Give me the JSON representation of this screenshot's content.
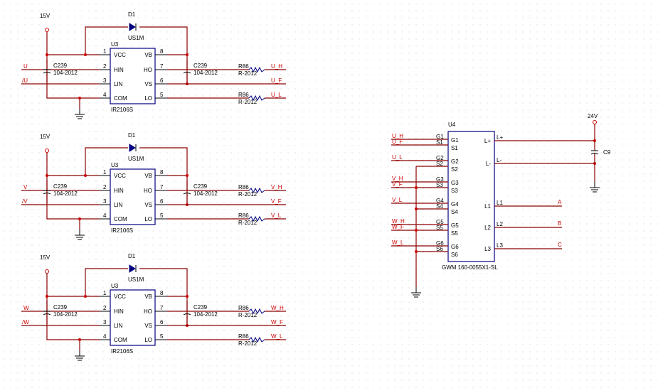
{
  "colors": {
    "background": "#ffffff",
    "wire": "#8b0000",
    "net_label": "#cc0000",
    "ic_outline": "#000080",
    "grid_dot": "#c8c8c8"
  },
  "drivers": [
    {
      "supply": "15V",
      "diode": {
        "ref": "D1",
        "part": "US1M"
      },
      "ic": {
        "ref": "U3",
        "part": "IR2106S",
        "left_pins": [
          {
            "num": "1",
            "name": "VCC"
          },
          {
            "num": "2",
            "name": "HIN"
          },
          {
            "num": "3",
            "name": "LIN"
          },
          {
            "num": "4",
            "name": "COM"
          }
        ],
        "right_pins": [
          {
            "num": "8",
            "name": "VB"
          },
          {
            "num": "7",
            "name": "HO"
          },
          {
            "num": "6",
            "name": "VS"
          },
          {
            "num": "5",
            "name": "LO"
          }
        ]
      },
      "cap_left": {
        "ref": "C239",
        "value": "104-2012"
      },
      "cap_right": {
        "ref": "C239",
        "value": "104-2012"
      },
      "inputs": [
        "U",
        "/U"
      ],
      "res_top": {
        "ref": "R86",
        "value": "R-2012"
      },
      "res_bot": {
        "ref": "R86",
        "value": "R-2012"
      },
      "outputs": [
        "U_H",
        "U_F",
        "U_L"
      ]
    },
    {
      "supply": "15V",
      "diode": {
        "ref": "D1",
        "part": "US1M"
      },
      "ic": {
        "ref": "U3",
        "part": "IR2106S",
        "left_pins": [
          {
            "num": "1",
            "name": "VCC"
          },
          {
            "num": "2",
            "name": "HIN"
          },
          {
            "num": "3",
            "name": "LIN"
          },
          {
            "num": "4",
            "name": "COM"
          }
        ],
        "right_pins": [
          {
            "num": "8",
            "name": "VB"
          },
          {
            "num": "7",
            "name": "HO"
          },
          {
            "num": "6",
            "name": "VS"
          },
          {
            "num": "5",
            "name": "LO"
          }
        ]
      },
      "cap_left": {
        "ref": "C239",
        "value": "104-2012"
      },
      "cap_right": {
        "ref": "C239",
        "value": "104-2012"
      },
      "inputs": [
        "V",
        "/V"
      ],
      "res_top": {
        "ref": "R86",
        "value": "R-2012"
      },
      "res_bot": {
        "ref": "R86",
        "value": "R-2012"
      },
      "outputs": [
        "V_H",
        "V_F",
        "V_L"
      ]
    },
    {
      "supply": "15V",
      "diode": {
        "ref": "D1",
        "part": "US1M"
      },
      "ic": {
        "ref": "U3",
        "part": "IR2106S",
        "left_pins": [
          {
            "num": "1",
            "name": "VCC"
          },
          {
            "num": "2",
            "name": "HIN"
          },
          {
            "num": "3",
            "name": "LIN"
          },
          {
            "num": "4",
            "name": "COM"
          }
        ],
        "right_pins": [
          {
            "num": "8",
            "name": "VB"
          },
          {
            "num": "7",
            "name": "HO"
          },
          {
            "num": "6",
            "name": "VS"
          },
          {
            "num": "5",
            "name": "LO"
          }
        ]
      },
      "cap_left": {
        "ref": "C239",
        "value": "104-2012"
      },
      "cap_right": {
        "ref": "C239",
        "value": "104-2012"
      },
      "inputs": [
        "W",
        "/W"
      ],
      "res_top": {
        "ref": "R86",
        "value": "R-2012"
      },
      "res_bot": {
        "ref": "R86",
        "value": "R-2012"
      },
      "outputs": [
        "W_H",
        "W_F",
        "W_L"
      ]
    }
  ],
  "module": {
    "ref": "U4",
    "part": "GWM 160-0055X1-SL",
    "left_pins": [
      {
        "net": "U_H",
        "num": "G1",
        "name": "G1"
      },
      {
        "net": "U_F",
        "num": "S1",
        "name": "S1"
      },
      {
        "net": "U_L",
        "num": "G2",
        "name": "G2"
      },
      {
        "net": "",
        "num": "S2",
        "name": "S2"
      },
      {
        "net": "V_H",
        "num": "G3",
        "name": "G3"
      },
      {
        "net": "V_F",
        "num": "S3",
        "name": "S3"
      },
      {
        "net": "V_L",
        "num": "G4",
        "name": "G4"
      },
      {
        "net": "",
        "num": "S4",
        "name": "S4"
      },
      {
        "net": "W_H",
        "num": "G5",
        "name": "G5"
      },
      {
        "net": "W_F",
        "num": "S5",
        "name": "S5"
      },
      {
        "net": "W_L",
        "num": "G6",
        "name": "G6"
      },
      {
        "net": "",
        "num": "S6",
        "name": "S6"
      }
    ],
    "right_pins": [
      {
        "num": "L+",
        "name": "L+",
        "net": ""
      },
      {
        "num": "L-",
        "name": "L-",
        "net": ""
      },
      {
        "num": "L1",
        "name": "L1",
        "net": "A"
      },
      {
        "num": "L2",
        "name": "L2",
        "net": "B"
      },
      {
        "num": "L3",
        "name": "L3",
        "net": "C"
      }
    ],
    "supply": "24V",
    "cap": "C9"
  }
}
